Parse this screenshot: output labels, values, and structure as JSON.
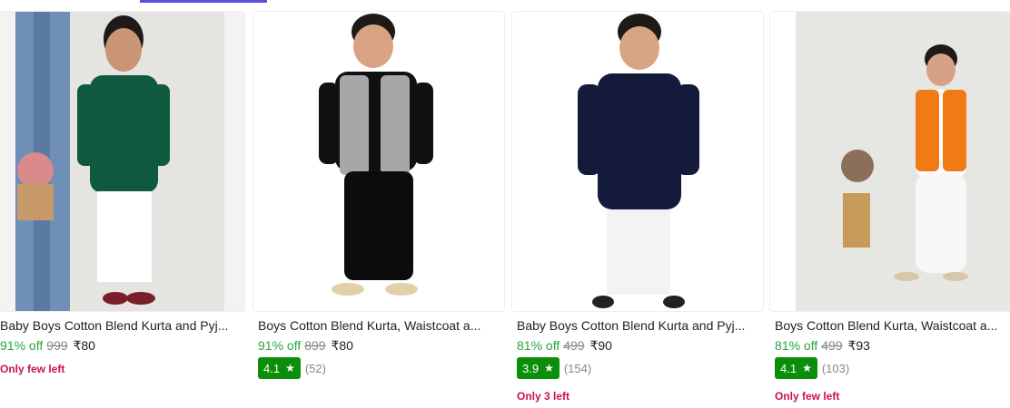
{
  "colors": {
    "accent": "#5b4fe0",
    "discount": "#26a541",
    "rating": "#0b8f0b",
    "stock": "#c8115a"
  },
  "products": [
    {
      "title": "Baby Boys Cotton Blend Kurta and Pyj...",
      "discount": "91% off",
      "mrp": "999",
      "price": "₹80",
      "rating": "",
      "rating_count": "",
      "stock": "Only few left"
    },
    {
      "title": "Boys Cotton Blend Kurta, Waistcoat a...",
      "discount": "91% off",
      "mrp": "899",
      "price": "₹80",
      "rating": "4.1",
      "rating_count": "(52)",
      "stock": ""
    },
    {
      "title": "Baby Boys Cotton Blend Kurta and Pyj...",
      "discount": "81% off",
      "mrp": "499",
      "price": "₹90",
      "rating": "3.9",
      "rating_count": "(154)",
      "stock": "Only 3 left"
    },
    {
      "title": "Boys Cotton Blend Kurta, Waistcoat a...",
      "discount": "81% off",
      "mrp": "499",
      "price": "₹93",
      "rating": "4.1",
      "rating_count": "(103)",
      "stock": "Only few left"
    }
  ],
  "icons": {
    "rating": "star-icon"
  }
}
